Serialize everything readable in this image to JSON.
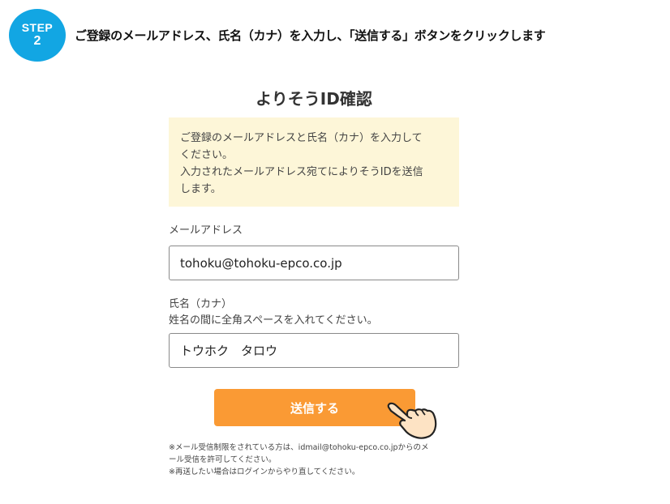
{
  "step": {
    "word": "STEP",
    "number": "2",
    "color": "#12a6e3"
  },
  "instruction": "ご登録のメールアドレス、氏名（カナ）を入力し、「送信する」ボタンをクリックします",
  "form": {
    "title": "よりそうID確認",
    "notice_lines": [
      "ご登録のメールアドレスと氏名（カナ）を入力して",
      "ください。",
      "入力されたメールアドレス宛てによりそうIDを送信",
      "します。"
    ],
    "email_label": "メールアドレス",
    "email_value": "tohoku@tohoku-epco.co.jp",
    "name_label": "氏名（カナ）",
    "name_hint": "姓名の間に全角スペースを入れてください。",
    "name_value": "トウホク　タロウ",
    "submit_label": "送信する",
    "accent_color": "#fa9a34",
    "footnotes": [
      "※メール受信制限をされている方は、idmail@tohoku-epco.co.jpからのメ",
      "ール受信を許可してください。",
      "※再送したい場合はログインからやり直してください。"
    ]
  },
  "icons": {
    "pointer": "pointing-hand-icon"
  }
}
